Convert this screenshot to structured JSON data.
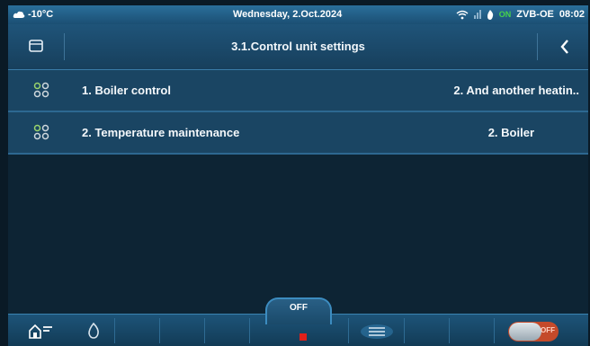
{
  "status": {
    "temperature": "-10°C",
    "date": "Wednesday, 2.Oct.2024",
    "on_tag": "ON",
    "device": "ZVB-OE",
    "time": "08:02"
  },
  "header": {
    "title": "3.1.Control unit settings"
  },
  "rows": [
    {
      "label": "1.  Boiler control",
      "value": "2. And another heatin.."
    },
    {
      "label": "2.  Temperature maintenance",
      "value": "2. Boiler"
    }
  ],
  "bottom": {
    "off_label": "OFF",
    "toggle_label": "OFF"
  },
  "colors": {
    "accent": "#2d6891",
    "status_on": "#46d34a",
    "stop": "#e0201a"
  }
}
